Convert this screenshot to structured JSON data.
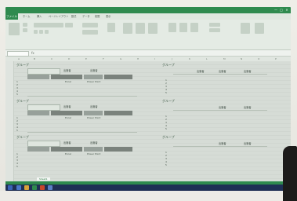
{
  "window": {
    "title": "",
    "controls": [
      "—",
      "□",
      "✕"
    ]
  },
  "menu": {
    "file": "ファイル",
    "tabs": [
      "ホーム",
      "挿入",
      "ページレイアウト",
      "数式",
      "データ",
      "校閲",
      "表示"
    ]
  },
  "formula_bar": {
    "fx": "fx"
  },
  "columns": [
    "A",
    "B",
    "C",
    "D",
    "E",
    "F",
    "G",
    "H",
    "I",
    "J",
    "K",
    "L",
    "M",
    "N",
    "O",
    "P"
  ],
  "groups": [
    {
      "title": "グループ",
      "headers": [
        "出席者",
        "出席者"
      ],
      "rows": [
        "1",
        "2",
        "3",
        "4",
        "5"
      ],
      "subheaders": [
        "Excel",
        "Power Point"
      ]
    },
    {
      "title": "グループ",
      "headers": [
        "出席者",
        "出席者"
      ],
      "rows": [
        "1",
        "2",
        "3",
        "4",
        "5"
      ],
      "subheaders": [
        "Excel",
        "Power Point"
      ]
    },
    {
      "title": "グループ",
      "headers": [
        "出席者",
        "出席者"
      ],
      "rows": [
        "1",
        "2",
        "3",
        "4",
        "5"
      ],
      "subheaders": [
        "Excel",
        "Power Point"
      ]
    }
  ],
  "right_groups": [
    {
      "title": "グループ",
      "headers": [
        "出席者",
        "出席者",
        "出席者"
      ],
      "rows": [
        "1",
        "2",
        "3",
        "4",
        "5"
      ]
    },
    {
      "title": "グループ",
      "headers": [
        "出席者",
        "出席者"
      ],
      "rows": [
        "1",
        "2",
        "3",
        "4",
        "5"
      ]
    },
    {
      "title": "グループ",
      "headers": [
        "出席者",
        "出席者"
      ],
      "rows": [
        "1",
        "2",
        "3",
        "4",
        "5"
      ]
    }
  ],
  "sheet_tab": "Sheet1",
  "colors": {
    "excel_green": "#2f8a4e",
    "taskbar": "#1f2f55"
  }
}
